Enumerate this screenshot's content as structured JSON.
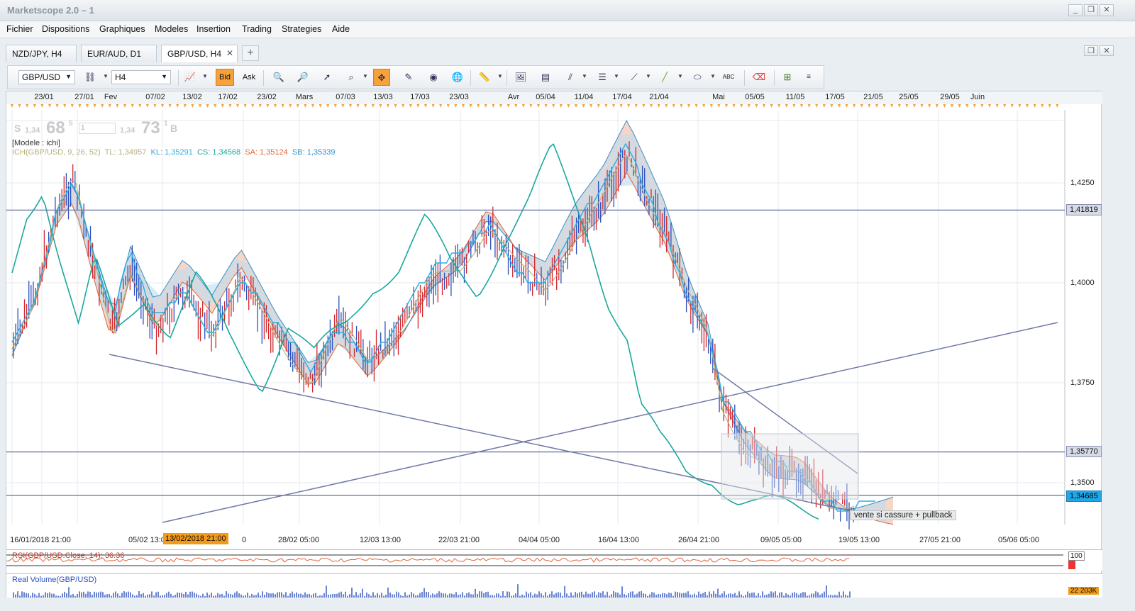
{
  "window": {
    "title": "Marketscope 2.0 – 1",
    "controls": [
      "_",
      "❐",
      "✕"
    ]
  },
  "menu": {
    "items": [
      "Fichier",
      "Dispositions",
      "Graphiques",
      "Modeles",
      "Insertion",
      "Trading",
      "Strategies",
      "Aide"
    ]
  },
  "tabs": {
    "items": [
      {
        "label": "NZD/JPY, H4"
      },
      {
        "label": "EUR/AUD, D1"
      },
      {
        "label": "GBP/USD, H4",
        "active": true,
        "close": "✕"
      }
    ],
    "add": "+"
  },
  "toolbar": {
    "instrument": "GBP/USD",
    "period": "H4",
    "bid": "Bid",
    "ask": "Ask",
    "abc": "ABC"
  },
  "chart": {
    "top_dates": [
      "23/01",
      "27/01",
      "Fev",
      "07/02",
      "13/02",
      "17/02",
      "23/02",
      "Mars",
      "07/03",
      "13/03",
      "17/03",
      "23/03",
      "Avr",
      "05/04",
      "11/04",
      "17/04",
      "21/04",
      "Mai",
      "05/05",
      "11/05",
      "17/05",
      "21/05",
      "25/05",
      "29/05",
      "Juin"
    ],
    "quote": {
      "sell_label": "S",
      "sell_pre": "1,34",
      "sell_big": "68",
      "sell_sup": "5",
      "field": "1",
      "buy_pre": "1,34",
      "buy_big": "73",
      "buy_sup": "1",
      "buy_label": "B"
    },
    "model": "[Modele : ichi]",
    "legend": {
      "ich": "ICH(GBP/USD, 9, 26, 52)",
      "tl": "TL: 1,34957",
      "kl": "KL: 1,35291",
      "cs": "CS: 1,34568",
      "sa": "SA: 1,35124",
      "sb": "SB: 1,35339"
    },
    "price_axis": [
      "1,4250",
      "1,4000",
      "1,3750",
      "1,3500"
    ],
    "levels": [
      "1,41819",
      "1,35770",
      "1,34685"
    ],
    "bottom_dates": [
      "16/01/2018 21:00",
      "05/02 13:00",
      "0",
      "28/02 05:00",
      "12/03 13:00",
      "22/03 21:00",
      "04/04 05:00",
      "16/04 13:00",
      "26/04 21:00",
      "09/05 05:00",
      "19/05 13:00",
      "27/05 21:00",
      "05/06 05:00"
    ],
    "crosshair_date": "13/02/2018 21:00",
    "annotation": "vente si cassure + pullback",
    "colors": {
      "tenkan": "#b5b07a",
      "kijun": "#2aaee6",
      "chikou": "#1aa89e",
      "span_a": "#e0643a",
      "span_b": "#3390c8",
      "bull": "#2a4fbf",
      "bear": "#d2262a",
      "levels": "#7078a6"
    }
  },
  "rsi_pane": {
    "label": "RSI(GBP/USD.Close, 14): 36.36",
    "level": "100"
  },
  "volume_pane": {
    "label": "Real Volume(GBP/USD)",
    "value": "22 203K"
  }
}
